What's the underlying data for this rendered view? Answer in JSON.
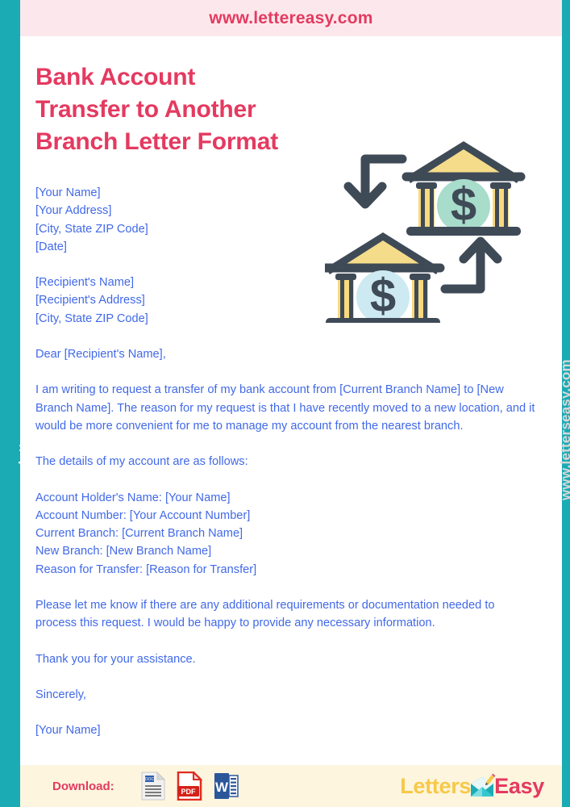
{
  "site": {
    "header_url": "www.lettereasy.com",
    "watermark_left": "www.letterseasy.com",
    "watermark_right": "www.letterseasy.com"
  },
  "title": {
    "line1": "Bank Account",
    "line2": "Transfer to Another",
    "line3": "Branch Letter Format"
  },
  "letter": {
    "sender": {
      "name": "[Your Name]",
      "address": "[Your Address]",
      "city_state_zip": "[City, State ZIP Code]",
      "date": "[Date]"
    },
    "recipient": {
      "name": "[Recipient's Name]",
      "address": "[Recipient's Address]",
      "city_state_zip": "[City, State ZIP Code]"
    },
    "salutation": "Dear [Recipient's Name],",
    "paragraph_1": "I am writing to request a transfer of my bank account from [Current Branch Name] to [New Branch Name]. The reason for my request is that I have recently moved to a new location, and it would be more convenient for me to manage my account from the nearest branch.",
    "details_intro": "The details of my account are as follows:",
    "details": [
      "Account Holder's Name: [Your Name]",
      "Account Number: [Your Account Number]",
      "Current Branch: [Current Branch Name]",
      "New Branch: [New Branch Name]",
      "Reason for Transfer: [Reason for Transfer]"
    ],
    "paragraph_2": "Please let me know if there are any additional requirements or documentation needed to process this request. I would be happy to provide any necessary information.",
    "thanks": "Thank you for your assistance.",
    "closing": "Sincerely,",
    "signature": "[Your Name]"
  },
  "footer": {
    "download_label": "Download:",
    "icons": [
      {
        "name": "doc-file-icon",
        "label": "DOC"
      },
      {
        "name": "pdf-file-icon",
        "label": "PDF"
      },
      {
        "name": "word-file-icon",
        "label": "W"
      }
    ],
    "brand": {
      "part1": "Letters",
      "part2": "Easy"
    }
  },
  "colors": {
    "teal": "#1BABB4",
    "pink_header": "#FCE8EC",
    "accent_red": "#E43A60",
    "body_blue": "#4169E8",
    "cream": "#FDF5DE",
    "brand_yellow": "#F7C948",
    "illustration_dark": "#3F4A57",
    "illustration_yellow": "#F5DC8A",
    "illustration_mint": "#A8DCCB",
    "illustration_ice": "#CDE9F2"
  },
  "illustration": {
    "name": "bank-transfer-illustration",
    "description": "Two bank buildings with dollar signs connected by down and up arrows"
  }
}
